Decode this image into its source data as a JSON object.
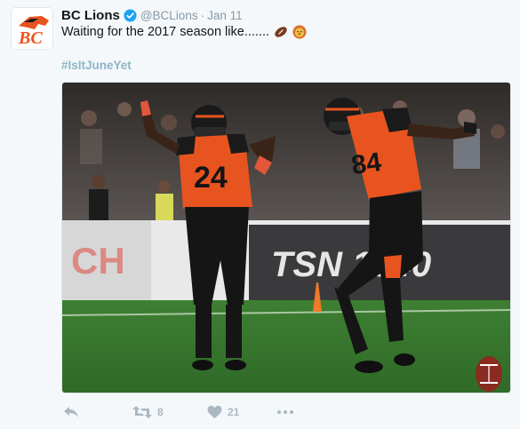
{
  "tweet": {
    "display_name": "BC Lions",
    "screen_name": "@BCLions",
    "separator": "·",
    "timestamp": "Jan 11",
    "text": "Waiting for the 2017 season like.......",
    "hashtag": "#IsItJuneYet",
    "emojis": [
      "football-emoji",
      "lion-face-emoji"
    ],
    "verified": true
  },
  "media": {
    "description_icons": [
      "photo"
    ],
    "players": [
      {
        "jersey_number": "24"
      },
      {
        "jersey_number": "84"
      }
    ],
    "banner_text": "TSN 1040"
  },
  "actions": {
    "retweet_count": "8",
    "like_count": "21"
  },
  "colors": {
    "brand_orange": "#e8541f",
    "link_blue": "#8fb4c9",
    "muted_gray": "#8899a6",
    "verified_blue": "#1da1f2",
    "background": "#f5f8fa"
  }
}
